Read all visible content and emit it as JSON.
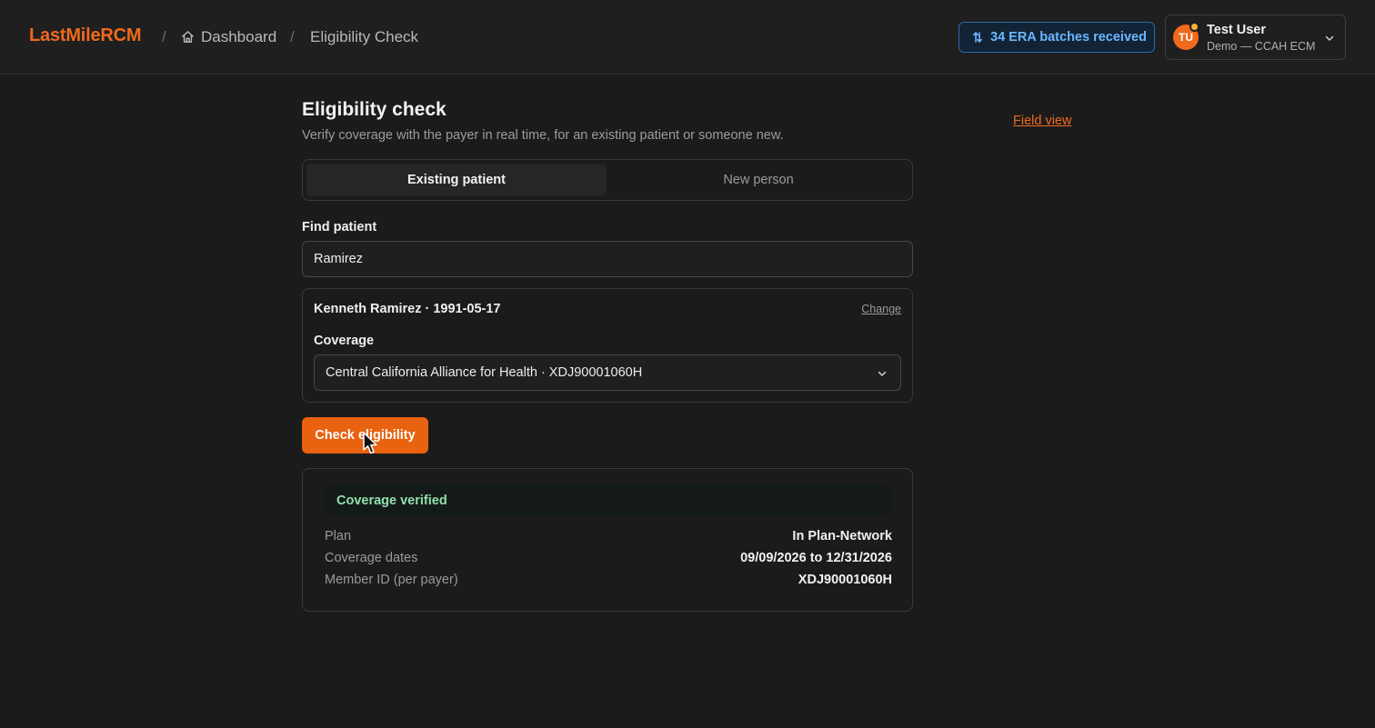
{
  "header": {
    "brand": "LastMileRCM",
    "breadcrumb": {
      "separator": "/",
      "home_label": "Dashboard",
      "current": "Eligibility Check"
    },
    "era_badge": "34 ERA batches received",
    "user": {
      "initials": "TU",
      "name": "Test User",
      "org": "Demo — CCAH ECM"
    }
  },
  "main": {
    "title": "Eligibility check",
    "subtitle": "Verify coverage with the payer in real time, for an existing patient or someone new.",
    "field_view_link": "Field view",
    "tabs": [
      {
        "label": "Existing patient",
        "active": true
      },
      {
        "label": "New person",
        "active": false
      }
    ],
    "find_patient": {
      "label": "Find patient",
      "value": "Ramirez"
    },
    "patient": {
      "summary": "Kenneth Ramirez · 1991-05-17",
      "change_label": "Change",
      "coverage_label": "Coverage",
      "coverage_value": "Central California Alliance for Health · XDJ90001060H"
    },
    "check_button": "Check eligibility",
    "result": {
      "status": "Coverage verified",
      "rows": [
        {
          "key": "Plan",
          "value": "In Plan-Network"
        },
        {
          "key": "Coverage dates",
          "value": "09/09/2026 to 12/31/2026"
        },
        {
          "key": "Member ID (per payer)",
          "value": "XDJ90001060H"
        }
      ]
    }
  },
  "colors": {
    "accent": "#f06a1d",
    "info": "#6ab6ff",
    "success": "#8fe0ad",
    "background": "#1b1b1b"
  },
  "icons": [
    "home-icon",
    "sync-arrows-icon",
    "chevron-down-icon",
    "mouse-cursor-icon"
  ]
}
